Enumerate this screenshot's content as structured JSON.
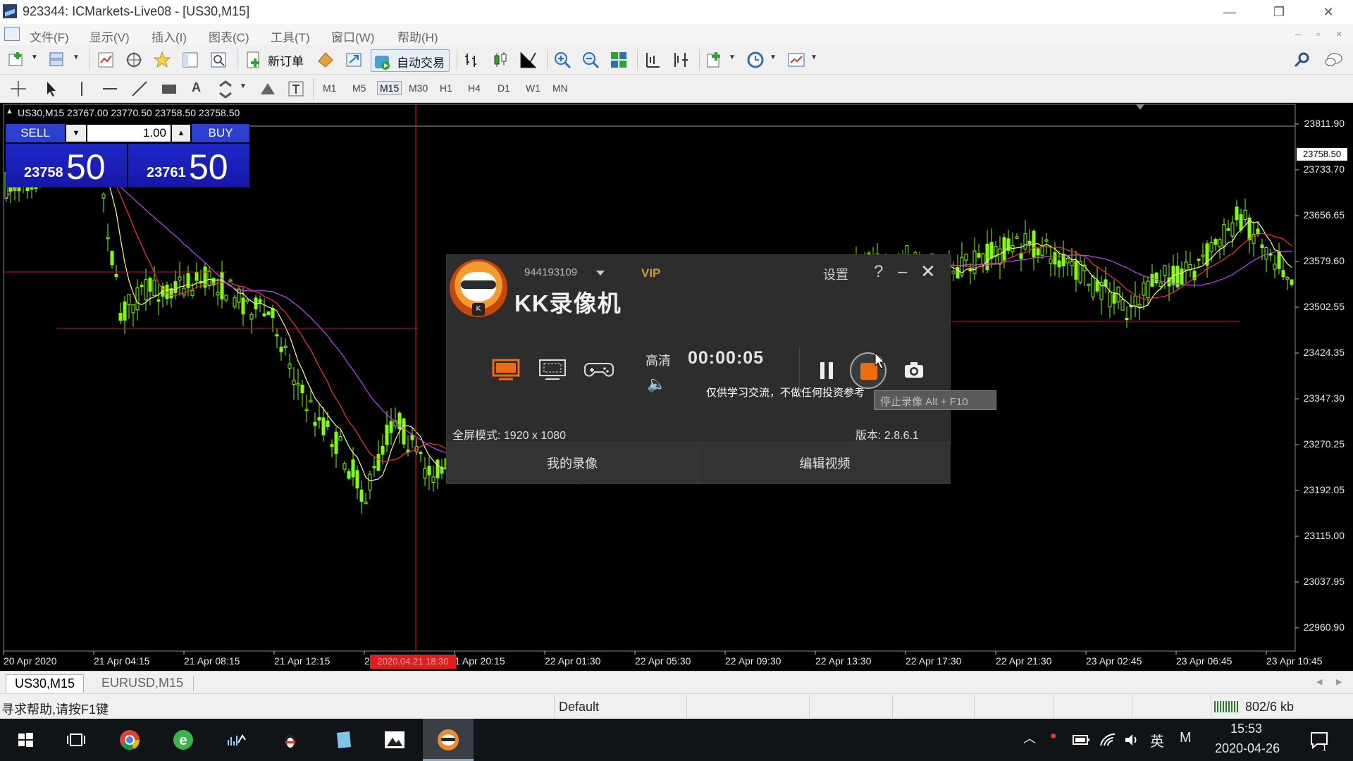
{
  "window": {
    "title": "923344: ICMarkets-Live08 - [US30,M15]"
  },
  "menu": [
    "文件(F)",
    "显示(V)",
    "插入(I)",
    "图表(C)",
    "工具(T)",
    "窗口(W)",
    "帮助(H)"
  ],
  "toolbar": {
    "new_order_label": "新订单",
    "auto_trading_label": "自动交易"
  },
  "timeframes": [
    "M1",
    "M5",
    "M15",
    "M30",
    "H1",
    "H4",
    "D1",
    "W1",
    "MN"
  ],
  "active_timeframe": "M15",
  "chart": {
    "header": "US30,M15  23767.00 23770.50 23758.50 23758.50",
    "current_price_label": "23758.50",
    "price_ticks": [
      "23811.90",
      "23733.70",
      "23656.65",
      "23579.60",
      "23502.55",
      "23424.35",
      "23347.30",
      "23270.25",
      "23192.05",
      "23115.00",
      "23037.95",
      "22960.90"
    ],
    "time_ticks": [
      "20 Apr 2020",
      "21 Apr 04:15",
      "21 Apr 08:15",
      "21 Apr 12:15",
      "2",
      "1 Apr 20:15",
      "22 Apr 01:30",
      "22 Apr 05:30",
      "22 Apr 09:30",
      "22 Apr 13:30",
      "22 Apr 17:30",
      "22 Apr 21:30",
      "23 Apr 02:45",
      "23 Apr 06:45",
      "23 Apr 10:45"
    ],
    "crosshair_time": "2020.04.21 18:30",
    "colors": {
      "bull": "#7fff00",
      "ma_fast": "#ffff80",
      "ma_mid": "#ff3030",
      "ma_slow": "#c040ff",
      "bg": "#000000"
    }
  },
  "one_click": {
    "sell_label": "SELL",
    "buy_label": "BUY",
    "lot": "1.00",
    "sell_price_small": "23758",
    "sell_price_big": "50",
    "buy_price_small": "23761",
    "buy_price_big": "50"
  },
  "kk_recorder": {
    "account": "944193109",
    "vip": "VIP",
    "brand": "KK录像机",
    "settings_label": "设置",
    "help": "?",
    "minimize": "–",
    "close": "✕",
    "quality": "高清",
    "timer": "00:00:05",
    "notice": "仅供学习交流，不做任何投资参考",
    "tooltip": "停止录像 Alt + F10",
    "fullscreen": "全屏模式: 1920 x 1080",
    "version": "版本: 2.8.6.1",
    "my_recordings": "我的录像",
    "edit_video": "编辑视频",
    "modes": [
      "fullscreen-mode-icon",
      "region-mode-icon",
      "game-mode-icon"
    ]
  },
  "tabs": [
    "US30,M15",
    "EURUSD,M15"
  ],
  "status": {
    "help_text": "寻求帮助,请按F1键",
    "profile": "Default",
    "traffic": "802/6 kb"
  },
  "taskbar": {
    "ime": "英",
    "ime2": "M",
    "time": "15:53",
    "date": "2020-04-26"
  }
}
